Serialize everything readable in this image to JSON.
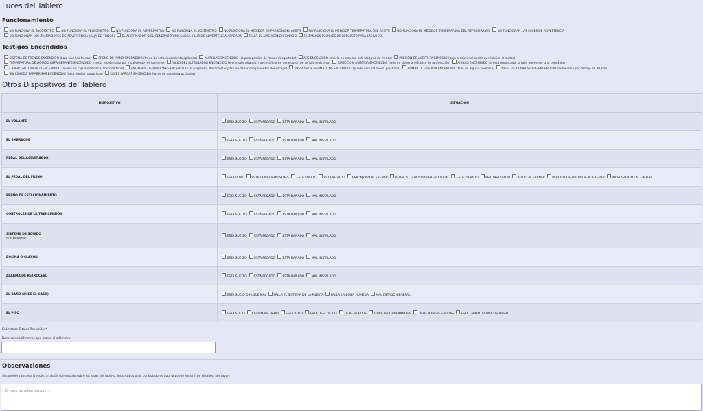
{
  "luces": {
    "title": "Luces del Tablero",
    "funcionamiento": {
      "title": "Funcionamiento",
      "lines": [
        [
          "NO FUNCIONA EL TACÓMETRO",
          "NO FUNCIONA EL VELOCÍMETRO",
          "NO FUNCIONA EL AMPERÍMETRO",
          "NO FUNCIONA EL VOLTÍMETRO",
          "NO FUNCIONA EL MEDIDOR DE PRESIÓN DEL ACEITE",
          "NO FUNCIONA EL MEDIDOR TEMPERATURA DEL ACEITE",
          "NO FUNCIONA EL MEDIDOR TEMPERATURA DEL REFRIGERANTE",
          "NO FUNCIONAN LAS LUCES DE ADVERTENCIA"
        ],
        [
          "NO FUNCIONAN LOS ZUMBADORES DE ADVERTENCIA (CAJA DE TONOS)",
          "EL ALTERNADOR O EL GENERADOR NO CARGA Y LUZ DE ADVERTENCIA APAGADA",
          "FALLA EL AIRE ACONDICIONADO",
          "FALTAN LOS FUSIBLES DE REPUESTO PARA LAS LUCES"
        ]
      ]
    },
    "testigos": {
      "title": "Testigos Encendidos",
      "lines": [
        [
          "SISTEMA DE FRENOS ENCENDIDO (bajo nivel de frenos)",
          "FRENO DE MANO ENCENDIDO (freno de estacionamiento aplicado)",
          "PASTILLAS ENCENDIDO (alguna pastilla de frenos desgastada)",
          "ABS ENCENDIDO (avería en sistema anti bloqueo de frenos)",
          "PRESIÓN DE ACEITE ENCENDIDO (baja presión del aceite que lubrica el motor)"
        ],
        [
          "TEMPERATURA DE LÍQUIDO REFRIGERANTE ENCENDIDO (motor recalentado por insuficiente refrigerante)",
          "FALLO DEL ALTERNADOR ENCENDIDO (y el motor girando, hay insuficiente generación de tensión eléctrica)",
          "DIRECCIÓN ASISTIDA ENCENDIDO (fallo en sistema eléctrico de la dirección)",
          "AIRBAG ENCENDIDO (si está empacado, la falla puede ser una conexión)"
        ],
        [
          "CAMBIO AUTOMÁTICO ENCENDIDO (avería en caja automática, tracción total)",
          "ANOMALÍA DE EMISIONES ENCENDIDO (si parpadea, desacelerar para no dañar componentes del escape)",
          "PRESIÓN DE NEUMÁTICOS ENCENDIDO (puede ser una rueda pinchada)",
          "BOMBILLA FUNDIDA ENCENDIDA (falla en alguna bombilla)",
          "NIVEL DE COMBUSTIBLE ENCENDIDO (autonomía por debajo de 80 km)"
        ],
        [
          "SIN LÍQUIDO PARABRISAS ENCENDIDO (falta líquido parabrisas)",
          "LUCES LARGAS ENCENDIDO (luces de carretera activadas)"
        ]
      ]
    }
  },
  "otros": {
    "title": "Otros Dispositivos del Tablero",
    "col_device": "DISPOSITIVO",
    "col_status": "SITUACIÓN",
    "rows": [
      {
        "name": "EL VOLANTE",
        "note": "",
        "opts": [
          "ESTÁ SUELTO",
          "ESTÁ PEGADO",
          "ESTÁ DAÑADO",
          "MAL INSTALADO"
        ]
      },
      {
        "name": "EL EMBRAGUE",
        "note": "",
        "opts": [
          "ESTÁ SUELTO",
          "ESTÁ PEGADO",
          "ESTÁ DAÑADO",
          "MAL INSTALADO"
        ]
      },
      {
        "name": "PEDAL DEL ACELERADOR",
        "note": "",
        "opts": [
          "ESTÁ SUELTO",
          "ESTÁ PEGADO",
          "ESTÁ DAÑADO",
          "MAL INSTALADO"
        ]
      },
      {
        "name": "EL PEDAL DEL FRENO",
        "note": "",
        "opts": [
          "ESTÁ DURO",
          "ESTÁ DEMASIADO SUAVE",
          "ESTÁ SUELTO",
          "ESTÁ PEGADO",
          "ESPONJOSO AL FRENAR",
          "PEDAL AL FONDO SIN FRENO TOTAL",
          "ESTÁ DAÑADO",
          "MAL INSTALADO",
          "RUIDO AL FRENAR",
          "PÉRDIDA DE POTENCIA AL FRENAR",
          "INESTABILIDAD AL FRENAR"
        ]
      },
      {
        "name": "FRENO DE ESTACIONAMIENTO",
        "note": "",
        "opts": [
          "ESTÁ SUELTO",
          "ESTÁ PEGADO",
          "ESTÁ DAÑADO",
          "MAL INSTALADO"
        ]
      },
      {
        "name": "CONTROLES DE LA TRANSMISIÓN",
        "note": "",
        "opts": [
          "ESTÁ SUELTO",
          "ESTÁ PEGADO",
          "ESTÁ DAÑADO",
          "MAL INSTALADO"
        ]
      },
      {
        "name": "SISTEMA DE SONIDO",
        "note": "(si el auto tiene)",
        "opts": [
          "ESTÁ SUELTO",
          "ESTÁ PEGADO",
          "ESTÁ DAÑADO",
          "MAL INSTALADO"
        ]
      },
      {
        "name": "BOCINA O CLAXON",
        "note": "",
        "opts": [
          "ESTÁ SUELTO",
          "ESTÁ PEGADO",
          "ESTÁ DAÑADO",
          "MAL INSTALADO"
        ]
      },
      {
        "name": "ALARMA DE RETROCESO",
        "note": "",
        "opts": [
          "ESTÁ SUELTO",
          "ESTÁ PEGADO",
          "ESTÁ DAÑADO",
          "MAL INSTALADO"
        ]
      },
      {
        "name": "EL BAÑO (SI ES EL CASO)",
        "note": "",
        "opts": [
          "ESTÁ SUCIO O HUELE MAL",
          "FALLA EL SISTEMA DE LA PUERTA",
          "FALLA LA ZONA HÚMEDA",
          "MAL ESTADO GENERAL"
        ]
      },
      {
        "name": "EL PISO",
        "note": "",
        "opts": [
          "ESTÁ SUCIO",
          "ESTÁ MANCHADO",
          "ESTÁ ROTO",
          "ESTÁ DESCOCIDO",
          "TIENE HUECOS",
          "TIENE PROTUBERANCIAS",
          "TIENE PUNTAS SUELTAS",
          "ESTÁ EN MAL ESTADO GENERAL"
        ]
      }
    ]
  },
  "km": {
    "label": "Kilómetros Totales Recorridos*",
    "sublabel": "Número de kilómetros que marca el odómetro",
    "value": ""
  },
  "observaciones": {
    "title": "Observaciones",
    "help": "Si considera necesario registrar algún comentario sobre las luces del tablero, los testigos o los controladores aquí lo puede hacer (con detalles, por favor)",
    "placeholder": "El tono de advertencia ..."
  }
}
